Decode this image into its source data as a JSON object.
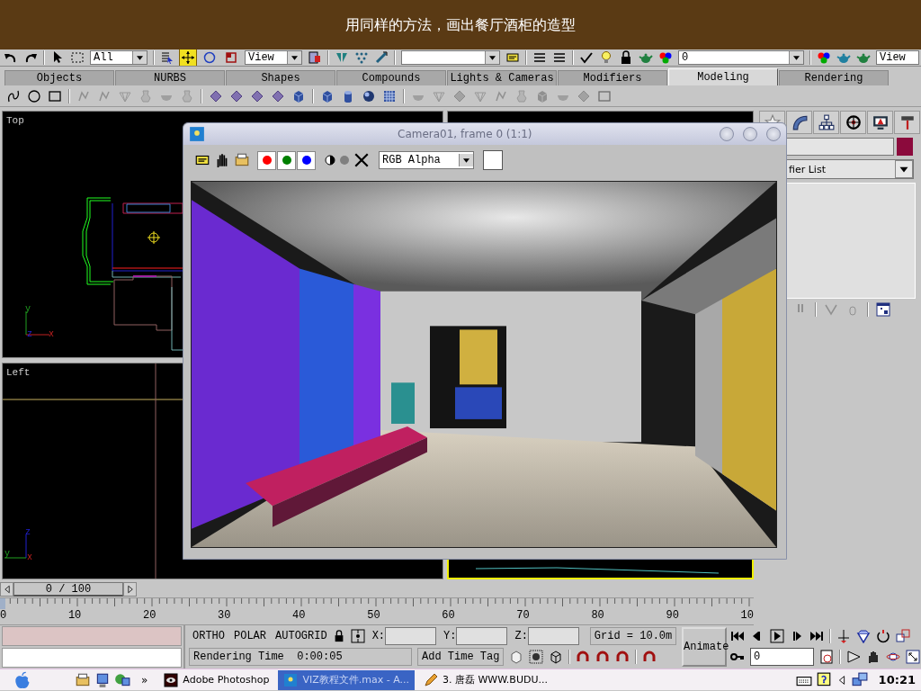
{
  "banner": {
    "caption": "用同样的方法，画出餐厅酒柜的造型"
  },
  "main_toolbar": {
    "selection_filter": "All",
    "coordinate_system": "View",
    "layer": "0",
    "render_type": "View",
    "transform_tools": [
      {
        "selected": true
      },
      {
        "selected": false
      },
      {
        "selected": false
      }
    ]
  },
  "tabs": [
    {
      "label": "Objects",
      "selected": false
    },
    {
      "label": "NURBS",
      "selected": false
    },
    {
      "label": "Shapes",
      "selected": false
    },
    {
      "label": "Compounds",
      "selected": false
    },
    {
      "label": "Lights & Cameras",
      "selected": false
    },
    {
      "label": "Modifiers",
      "selected": false
    },
    {
      "label": "Modeling",
      "selected": true
    },
    {
      "label": "Rendering",
      "selected": false
    }
  ],
  "modeling_toolbar": [
    {
      "disabled": false
    },
    {
      "disabled": false
    },
    {
      "disabled": false
    },
    {
      "disabled": true
    },
    {
      "disabled": true
    },
    {
      "disabled": true
    },
    {
      "disabled": true
    },
    {
      "disabled": true
    },
    {
      "disabled": true
    },
    {
      "disabled": false
    },
    {
      "disabled": false
    },
    {
      "disabled": false
    },
    {
      "disabled": false
    },
    {
      "disabled": false
    },
    {
      "disabled": false
    },
    {
      "disabled": false
    },
    {
      "disabled": false
    },
    {
      "disabled": false
    },
    {
      "disabled": true
    },
    {
      "disabled": true
    },
    {
      "disabled": true
    },
    {
      "disabled": true
    },
    {
      "disabled": true
    },
    {
      "disabled": true
    },
    {
      "disabled": true
    },
    {
      "disabled": true
    },
    {
      "disabled": true
    },
    {
      "disabled": true
    }
  ],
  "viewports": [
    {
      "label": "Top",
      "active": false,
      "axis_labels": [
        "y",
        "z",
        "x"
      ]
    },
    {
      "active": false
    },
    {
      "label": "Left",
      "active": false,
      "axis_labels": [
        "z",
        "y",
        "x"
      ]
    },
    {
      "active": true
    }
  ],
  "render_window": {
    "title": "Camera01, frame 0 (1:1)",
    "display": "RGB Alpha",
    "channels": [
      {
        "color": "#ff0000"
      },
      {
        "color": "#008000"
      },
      {
        "color": "#0000ff"
      }
    ]
  },
  "command_panel": {
    "modifier_list": "fier List"
  },
  "time_slider": {
    "position": "0 / 100",
    "ticks": [
      "0",
      "10",
      "20",
      "30",
      "40",
      "50",
      "60",
      "70",
      "80",
      "90",
      "10"
    ]
  },
  "status": {
    "modes": [
      "ORTHO",
      "POLAR",
      "AUTOGRID"
    ],
    "coords": [
      {
        "axis": "X:"
      },
      {
        "axis": "Y:"
      },
      {
        "axis": "Z:"
      }
    ],
    "grid": "Grid = 10.0m",
    "animate": "Animate",
    "prompt": "Rendering Time  0:00:05",
    "add_time_tag": "Add Time Tag",
    "frame": "0"
  },
  "taskbar": {
    "more": "»",
    "clock": "10:21",
    "items": [
      {
        "label": "Adobe Photoshop",
        "selected": false
      },
      {
        "label": "VIZ教程文件.max - A...",
        "selected": true
      },
      {
        "label": "3. 唐磊 WWW.BUDU...",
        "selected": false
      }
    ]
  }
}
